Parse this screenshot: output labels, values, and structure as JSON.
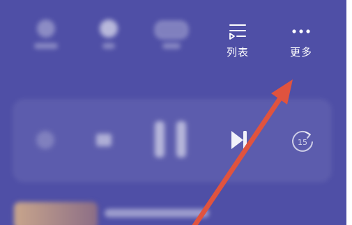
{
  "header": {
    "list_label": "列表",
    "more_label": "更多"
  },
  "player": {
    "replay_seconds": "15"
  },
  "icons": {
    "list": "playlist-icon",
    "more": "more-dots-icon",
    "next": "next-track-icon",
    "pause": "pause-icon",
    "replay": "forward-15-icon"
  },
  "colors": {
    "background": "#4f4fa6",
    "annotation_arrow": "#e0533e"
  }
}
